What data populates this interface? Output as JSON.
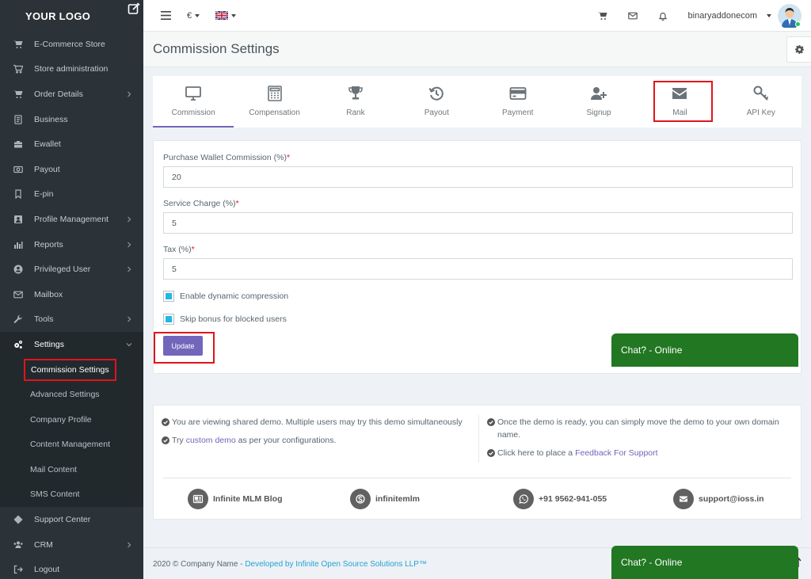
{
  "logo": {
    "text": "YOUR LOGO"
  },
  "sidebar": {
    "items": [
      {
        "label": "E-Commerce Store",
        "icon": "cart-icon",
        "chevron": false
      },
      {
        "label": "Store administration",
        "icon": "shopping-cart-icon",
        "chevron": false
      },
      {
        "label": "Order Details",
        "icon": "cart-icon",
        "chevron": true
      },
      {
        "label": "Business",
        "icon": "document-icon",
        "chevron": false
      },
      {
        "label": "Ewallet",
        "icon": "briefcase-icon",
        "chevron": false
      },
      {
        "label": "Payout",
        "icon": "money-icon",
        "chevron": false
      },
      {
        "label": "E-pin",
        "icon": "bookmark-icon",
        "chevron": false
      },
      {
        "label": "Profile Management",
        "icon": "profile-card-icon",
        "chevron": true
      },
      {
        "label": "Reports",
        "icon": "chart-icon",
        "chevron": true
      },
      {
        "label": "Privileged User",
        "icon": "user-circle-icon",
        "chevron": true
      },
      {
        "label": "Mailbox",
        "icon": "envelope-icon",
        "chevron": false
      },
      {
        "label": "Tools",
        "icon": "wrench-icon",
        "chevron": true
      },
      {
        "label": "Settings",
        "icon": "gears-icon",
        "chevron": true
      }
    ],
    "settings_sub": [
      {
        "label": "Commission Settings"
      },
      {
        "label": "Advanced Settings"
      },
      {
        "label": "Company Profile"
      },
      {
        "label": "Content Management"
      },
      {
        "label": "Mail Content"
      },
      {
        "label": "SMS Content"
      }
    ],
    "bottom_items": [
      {
        "label": "Support Center",
        "icon": "diamond-icon",
        "chevron": false
      },
      {
        "label": "CRM",
        "icon": "users-icon",
        "chevron": true
      },
      {
        "label": "Logout",
        "icon": "logout-icon",
        "chevron": false
      }
    ]
  },
  "topbar": {
    "currency": "€",
    "username": "binaryaddonecom"
  },
  "page": {
    "title": "Commission Settings"
  },
  "tabs": [
    {
      "label": "Commission",
      "icon": "monitor-icon"
    },
    {
      "label": "Compensation",
      "icon": "calculator-icon"
    },
    {
      "label": "Rank",
      "icon": "trophy-icon"
    },
    {
      "label": "Payout",
      "icon": "history-icon"
    },
    {
      "label": "Payment",
      "icon": "credit-card-icon"
    },
    {
      "label": "Signup",
      "icon": "user-plus-icon"
    },
    {
      "label": "Mail",
      "icon": "envelope-icon"
    },
    {
      "label": "API Key",
      "icon": "key-icon"
    }
  ],
  "form": {
    "purchase_label": "Purchase Wallet Commission (%)",
    "purchase_value": "20",
    "service_label": "Service Charge (%)",
    "service_value": "5",
    "tax_label": "Tax (%)",
    "tax_value": "5",
    "required_mark": "*",
    "check1": "Enable dynamic compression",
    "check2": "Skip bonus for blocked users",
    "update": "Update"
  },
  "chat": {
    "label": "Chat? - Online"
  },
  "info": {
    "line1": "You are viewing shared demo. Multiple users may try this demo simultaneously",
    "line2_pre": "Try ",
    "line2_link": "custom demo",
    "line2_post": " as per your configurations.",
    "line3": "Once the demo is ready, you can simply move the demo to your own domain name.",
    "line4_pre": "Click here to place a ",
    "line4_link": "Feedback For Support",
    "contacts": [
      {
        "label": "Infinite MLM Blog",
        "icon": "blog-icon"
      },
      {
        "label": "infinitemlm",
        "icon": "skype-icon"
      },
      {
        "label": "+91 9562-941-055",
        "icon": "whatsapp-icon"
      },
      {
        "label": "support@ioss.in",
        "icon": "mail-icon"
      }
    ]
  },
  "footer": {
    "text": "2020 © Company Name - ",
    "link": "Developed by Infinite Open Source Solutions LLP™"
  },
  "colors": {
    "accent": "#7266ba",
    "sidebar": "#2b3338",
    "chat": "#227722",
    "highlight": "#e0141c",
    "link": "#23a3d3"
  }
}
